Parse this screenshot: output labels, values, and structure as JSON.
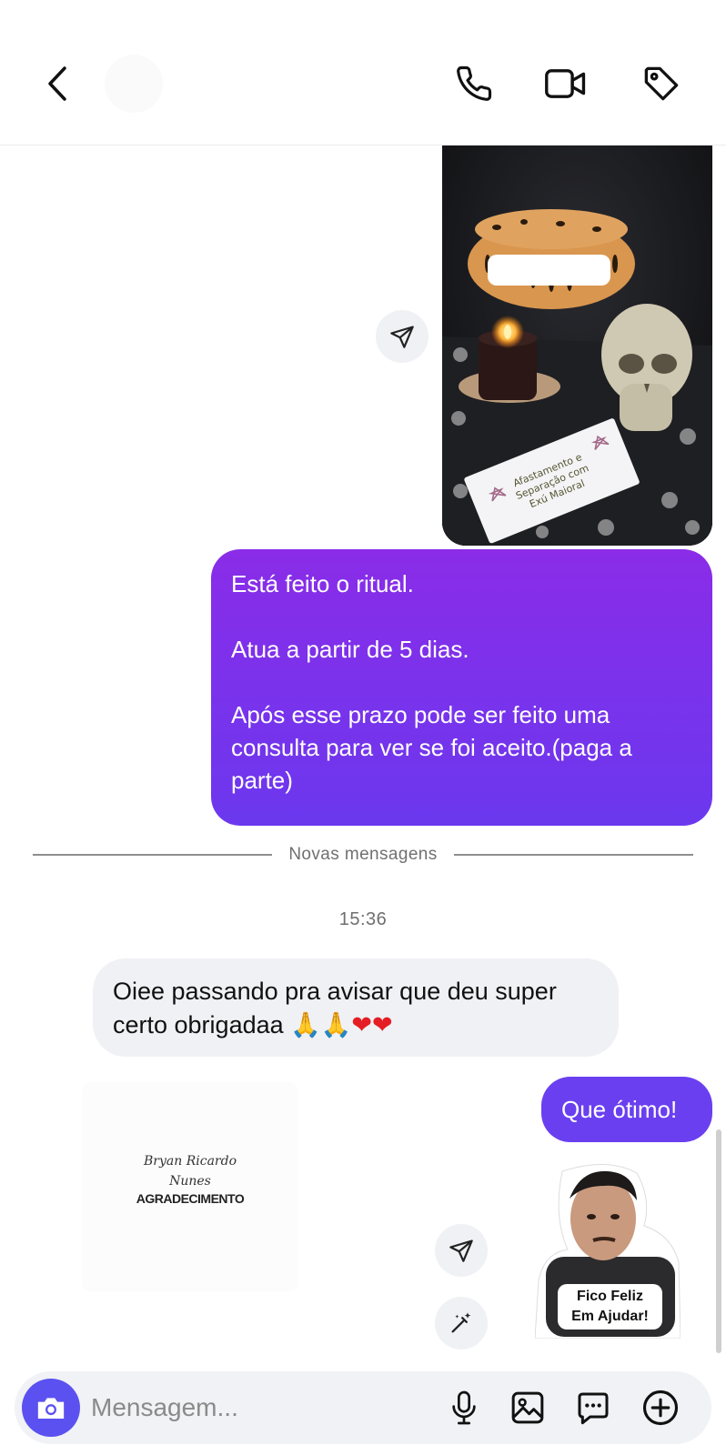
{
  "header": {
    "icons": {
      "back": "chevron-left-icon",
      "call": "phone-icon",
      "video": "video-camera-icon",
      "tag": "tag-icon"
    }
  },
  "messages": {
    "outgoing_main": "Está feito o ritual.\n\nAtua a partir de 5 dias.\n\nApós esse prazo pode ser feito uma consulta para ver se foi aceito.(paga a parte)",
    "outgoing_short": "Que ótimo!",
    "incoming_text": "Oiee passando pra avisar que deu super certo obrigadaa",
    "incoming_emojis": [
      "🙏",
      "🙏",
      "❤",
      "❤"
    ]
  },
  "photo": {
    "card_text": "Afastamento e Separação com Exú Maioral"
  },
  "divider": {
    "label": "Novas mensagens"
  },
  "timestamp": "15:36",
  "thank_card": {
    "script_line1": "Bryan Ricardo",
    "script_line2": "Nunes",
    "title": "AGRADECIMENTO"
  },
  "sticker": {
    "caption_line1": "Fico Feliz",
    "caption_line2": "Em Ajudar!"
  },
  "composer": {
    "placeholder": "Mensagem...",
    "icons": [
      "camera-icon",
      "microphone-icon",
      "gallery-icon",
      "sticker-icon",
      "plus-circle-icon"
    ]
  },
  "colors": {
    "accent": "#7534ea",
    "camera": "#5b51f0",
    "incoming_bg": "#eff1f4"
  }
}
